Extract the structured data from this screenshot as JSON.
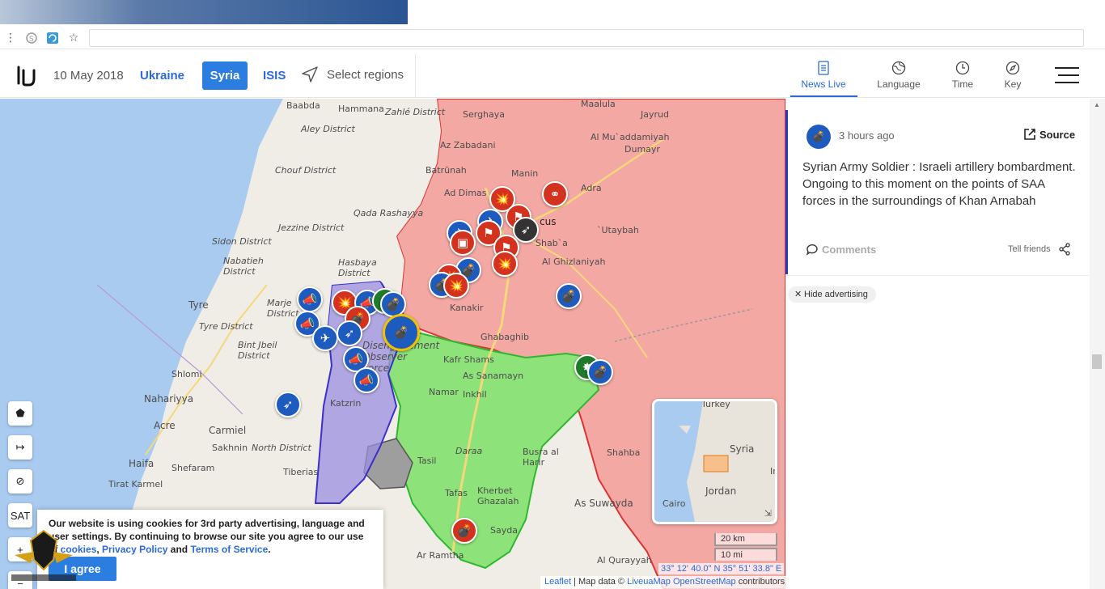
{
  "header": {
    "date": "10 May 2018",
    "tabs": [
      {
        "label": "Ukraine",
        "active": false
      },
      {
        "label": "Syria",
        "active": true
      },
      {
        "label": "ISIS",
        "active": false
      }
    ],
    "select_regions": "Select regions",
    "nav": [
      {
        "label": "News Live",
        "icon": "news-icon",
        "active": true
      },
      {
        "label": "Language",
        "icon": "globe-icon",
        "active": false
      },
      {
        "label": "Time",
        "icon": "clock-icon",
        "active": false
      },
      {
        "label": "Key",
        "icon": "compass-icon",
        "active": false
      }
    ]
  },
  "map": {
    "places": [
      {
        "text": "Baabda",
        "cls": ""
      },
      {
        "text": "Hammana",
        "cls": ""
      },
      {
        "text": "Zahlé District",
        "cls": "italic"
      },
      {
        "text": "Serghaya",
        "cls": ""
      },
      {
        "text": "Maalula",
        "cls": ""
      },
      {
        "text": "Jayrud",
        "cls": ""
      },
      {
        "text": "Aley District",
        "cls": "italic"
      },
      {
        "text": "Az Zabadani",
        "cls": ""
      },
      {
        "text": "Al Mu`addamiyah",
        "cls": ""
      },
      {
        "text": "Chouf District",
        "cls": "italic"
      },
      {
        "text": "Batrūnah",
        "cls": ""
      },
      {
        "text": "Manin",
        "cls": ""
      },
      {
        "text": "Dumayr",
        "cls": ""
      },
      {
        "text": "Ad Dimas",
        "cls": ""
      },
      {
        "text": "Adra",
        "cls": ""
      },
      {
        "text": "Qada Rashayya",
        "cls": "italic"
      },
      {
        "text": "Jezzine District",
        "cls": "italic"
      },
      {
        "text": "Sidon District",
        "cls": "italic"
      },
      {
        "text": "cus",
        "cls": "big"
      },
      {
        "text": "`Utaybah",
        "cls": ""
      },
      {
        "text": "Shab`a",
        "cls": ""
      },
      {
        "text": "Nabatieh District",
        "cls": "italic"
      },
      {
        "text": "Hasbaya District",
        "cls": "italic"
      },
      {
        "text": "Al Ghizlaniyah",
        "cls": ""
      },
      {
        "text": "Tyre",
        "cls": "big"
      },
      {
        "text": "Marje District",
        "cls": "italic"
      },
      {
        "text": "Kanakir",
        "cls": ""
      },
      {
        "text": "Tyre District",
        "cls": "italic"
      },
      {
        "text": "Bint Jbeil District",
        "cls": "italic"
      },
      {
        "text": "Ghabaghib",
        "cls": ""
      },
      {
        "text": "Kafr Shams",
        "cls": ""
      },
      {
        "text": "Shlomi",
        "cls": ""
      },
      {
        "text": "As Sanamayn",
        "cls": ""
      },
      {
        "text": "Nahariyya",
        "cls": "big"
      },
      {
        "text": "Katzrin",
        "cls": ""
      },
      {
        "text": "Namar",
        "cls": ""
      },
      {
        "text": "Inkhil",
        "cls": ""
      },
      {
        "text": "Acre",
        "cls": "big"
      },
      {
        "text": "Carmiel",
        "cls": "big"
      },
      {
        "text": "Sakhnin",
        "cls": ""
      },
      {
        "text": "North District",
        "cls": "italic"
      },
      {
        "text": "Daraa",
        "cls": "italic"
      },
      {
        "text": "Busra al Harir",
        "cls": ""
      },
      {
        "text": "Shahba",
        "cls": ""
      },
      {
        "text": "Haifa",
        "cls": "big"
      },
      {
        "text": "Tasil",
        "cls": ""
      },
      {
        "text": "Shefaram",
        "cls": ""
      },
      {
        "text": "Tiberias",
        "cls": ""
      },
      {
        "text": "Tirat Karmel",
        "cls": ""
      },
      {
        "text": "Tafas",
        "cls": ""
      },
      {
        "text": "Kherbet Ghazalah",
        "cls": ""
      },
      {
        "text": "As Suwayda",
        "cls": "big"
      },
      {
        "text": "Sayda",
        "cls": ""
      },
      {
        "text": "Ar Ramtha",
        "cls": ""
      },
      {
        "text": "Al Qurayyah",
        "cls": ""
      },
      {
        "text": "Disengagement Observer Force",
        "cls": "italic"
      }
    ],
    "minimap": {
      "turkey": "Turkey",
      "syria": "Syria",
      "iraq": "Ir",
      "jordan": "Jordan",
      "cairo": "Cairo"
    },
    "scale_km": "20 km",
    "scale_mi": "10 mi",
    "coords": "33° 12' 40.0\" N 35° 51' 33.8\" E",
    "attribution": {
      "leaflet": "Leaflet",
      "sep": " | Map data © ",
      "liveua": "LiveuaMap",
      "osm": "OpenStreetMap",
      "contrib": " contributors"
    },
    "tools": [
      "polygon-icon",
      "arrow-right-icon",
      "hide-eye-icon",
      "SAT",
      "+",
      "−"
    ]
  },
  "cookie": {
    "text1": "Our website is using cookies for 3rd party advertising, language and user settings. By continuing to browse our site you agree to our use of ",
    "link_cookies": "cookies",
    "text2": ", ",
    "link_privacy": "Privacy Policy",
    "text3": " and ",
    "link_terms": "Terms of Service",
    "text4": ".",
    "agree": "I agree"
  },
  "news": {
    "time": "3 hours ago",
    "source": "Source",
    "text": "Syrian Army Soldier : Israeli artillery bombardment. Ongoing to this moment on the points of SAA forces in the surroundings of Khan Arnabah",
    "comments": "Comments",
    "tell": "Tell friends",
    "hide_ad": "Hide advertising"
  },
  "colors": {
    "accent": "#2b7de0",
    "gov": "#f4a8a4",
    "rebel": "#8de27a",
    "israel_held": "#9b8fe0",
    "isis": "#9e9e9e"
  }
}
